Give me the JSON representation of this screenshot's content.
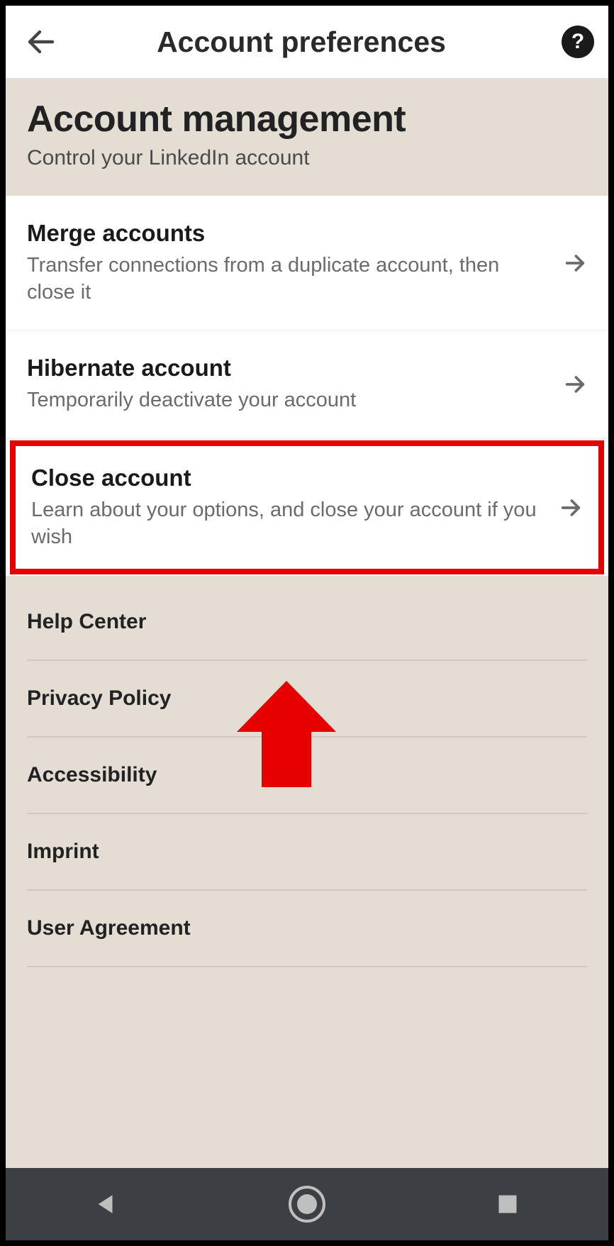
{
  "header": {
    "title": "Account preferences"
  },
  "section": {
    "title": "Account management",
    "subtitle": "Control your LinkedIn account"
  },
  "items": [
    {
      "title": "Merge accounts",
      "desc": "Transfer connections from a duplicate account, then close it"
    },
    {
      "title": "Hibernate account",
      "desc": "Temporarily deactivate your account"
    },
    {
      "title": "Close account",
      "desc": "Learn about your options, and close your account if you wish"
    }
  ],
  "footerLinks": [
    "Help Center",
    "Privacy Policy",
    "Accessibility",
    "Imprint",
    "User Agreement"
  ],
  "annotation": {
    "highlightColor": "#e60000"
  }
}
